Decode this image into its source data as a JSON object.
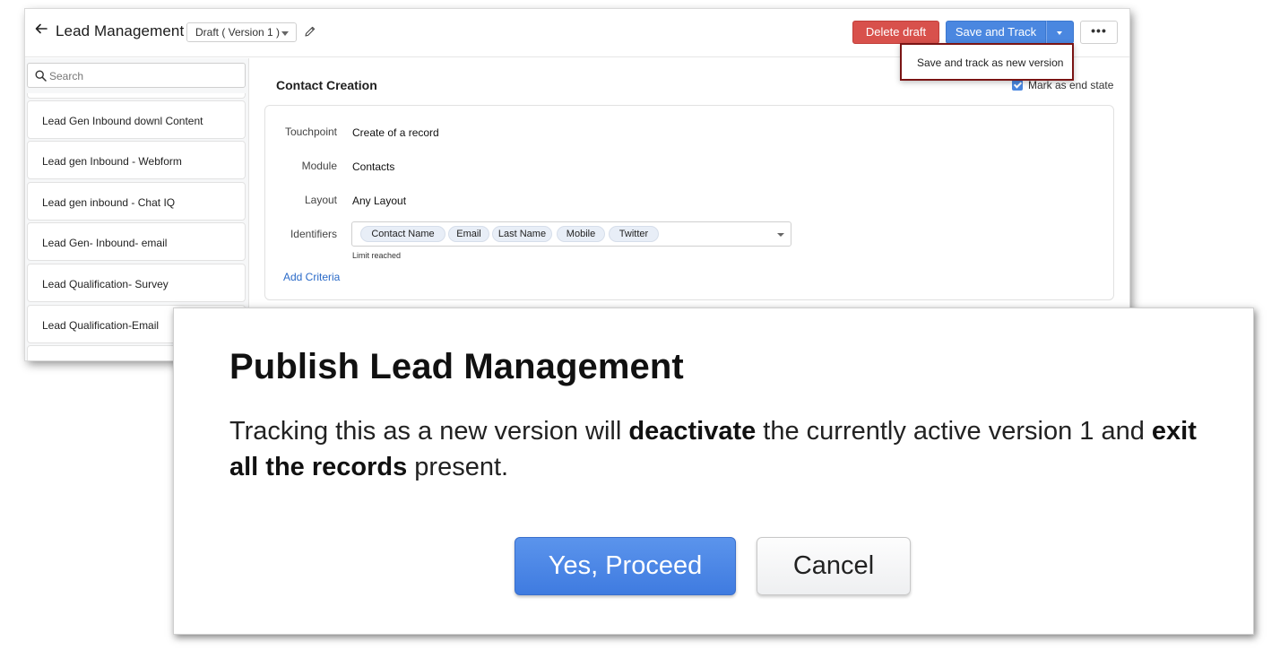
{
  "header": {
    "title": "Lead Management",
    "version_selected": "Draft ( Version 1 )",
    "delete_label": "Delete draft",
    "save_label": "Save and Track",
    "dropdown_option": "Save and track as new version"
  },
  "sidebar": {
    "search_placeholder": "Search",
    "items": [
      {
        "label": "Lead Gen Inbound downl Content"
      },
      {
        "label": "Lead gen Inbound - Webform"
      },
      {
        "label": "Lead gen inbound - Chat IQ"
      },
      {
        "label": "Lead Gen- Inbound- email"
      },
      {
        "label": "Lead Qualification- Survey"
      },
      {
        "label": "Lead Qualification-Email"
      }
    ]
  },
  "main": {
    "section_title": "Contact Creation",
    "end_state_label": "Mark as end state",
    "end_state_checked": true,
    "fields": {
      "touchpoint_label": "Touchpoint",
      "touchpoint_value": "Create of a record",
      "module_label": "Module",
      "module_value": "Contacts",
      "layout_label": "Layout",
      "layout_value": "Any Layout",
      "identifiers_label": "Identifiers"
    },
    "identifiers": [
      "Contact Name",
      "Email",
      "Last Name",
      "Mobile",
      "Twitter"
    ],
    "limit_text": "Limit reached",
    "add_criteria": "Add Criteria"
  },
  "modal": {
    "title": "Publish Lead Management",
    "body_part1": "Tracking this as a new version will ",
    "body_bold1": "deactivate",
    "body_part2": " the currently active version 1 and ",
    "body_bold2": "exit all the records",
    "body_part3": " present.",
    "proceed_label": "Yes, Proceed",
    "cancel_label": "Cancel"
  },
  "colors": {
    "primary": "#4a87e0",
    "danger": "#d8514c",
    "link": "#2a6ac8",
    "highlight_border": "#7a1414"
  }
}
